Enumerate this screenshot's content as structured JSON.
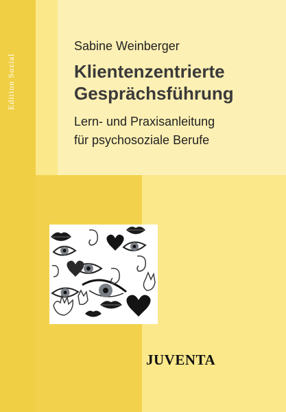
{
  "edition_label": "Edition Sozial",
  "author": "Sabine Weinberger",
  "title": [
    "Klientenzentrierte",
    "Gesprächsführung"
  ],
  "subtitle": [
    "Lern- und Praxisanleitung",
    "für psychosoziale Berufe"
  ],
  "publisher": "JUVENTA",
  "colors": {
    "background": "#fbe88a",
    "strip": "#f0cf44",
    "panel": "#fdf0b4",
    "title_text": "#3a3a3a"
  }
}
